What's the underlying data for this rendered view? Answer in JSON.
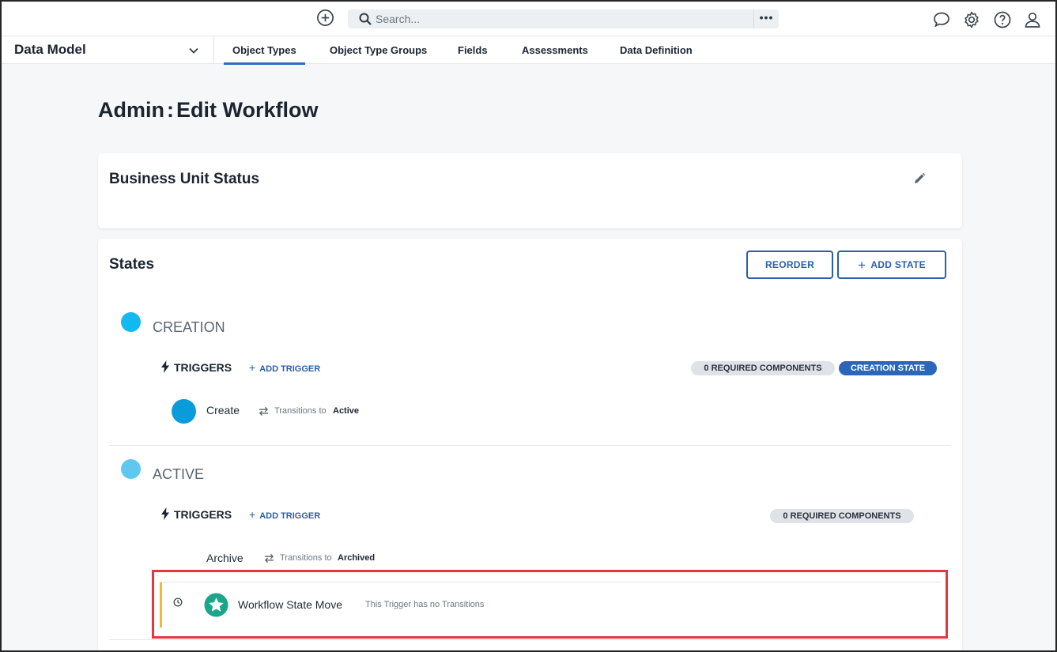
{
  "topbar": {
    "search_placeholder": "Search...",
    "more_label": "•••",
    "icons": [
      "add-circle-icon",
      "search-icon",
      "chat-icon",
      "gear-icon",
      "help-icon",
      "user-icon"
    ]
  },
  "navbar": {
    "module": "Data Model",
    "tabs": [
      {
        "label": "Object Types",
        "active": true
      },
      {
        "label": "Object Type Groups",
        "active": false
      },
      {
        "label": "Fields",
        "active": false
      },
      {
        "label": "Assessments",
        "active": false
      },
      {
        "label": "Data Definition",
        "active": false
      }
    ]
  },
  "page": {
    "title": "Admin : Edit Workflow",
    "title_parts": [
      "Admin",
      "Edit Workflow"
    ]
  },
  "workflow": {
    "name": "Business Unit Status"
  },
  "states_section": {
    "title": "States",
    "reorder_label": "REORDER",
    "add_state_label": "ADD STATE"
  },
  "states": [
    {
      "name": "CREATION",
      "color": "#12b8f0",
      "triggers_label": "TRIGGERS",
      "add_trigger_label": "ADD TRIGGER",
      "badges": [
        "0 REQUIRED COMPONENTS",
        "CREATION STATE"
      ],
      "triggers": [
        {
          "name": "Create",
          "transitions_label": "Transitions to",
          "target": "Active"
        }
      ]
    },
    {
      "name": "ACTIVE",
      "color": "#5fc8f0",
      "triggers_label": "TRIGGERS",
      "add_trigger_label": "ADD TRIGGER",
      "badges": [
        "0 REQUIRED COMPONENTS"
      ],
      "triggers": [
        {
          "name": "Archive",
          "transitions_label": "Transitions to",
          "target": "Archived"
        },
        {
          "name": "Workflow State Move",
          "note": "This Trigger has no Transitions"
        }
      ]
    }
  ],
  "colors": {
    "accent": "#2b5ea7",
    "highlight": "#e5373f",
    "trigger_dot": "#0a9bdb",
    "star_badge": "#1ba68a",
    "pending_bar": "#f3b73c"
  }
}
